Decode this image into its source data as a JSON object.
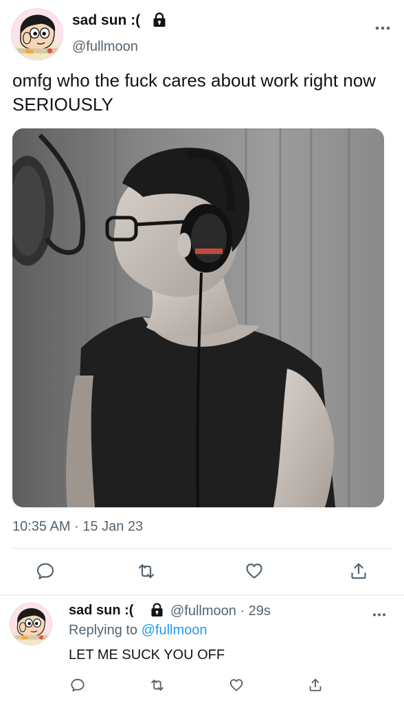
{
  "main_tweet": {
    "author": {
      "display_name": "sad sun :(",
      "handle": "@fullmoon",
      "avatar_icon": "cartoon-boy-avatar",
      "protected_icon": "lock-icon"
    },
    "text": "omfg who the fuck cares about work right now SERIOUSLY",
    "media": {
      "kind": "photo",
      "icon": "photo-man-with-headphones"
    },
    "timestamp": "10:35 AM · 15 Jan 23",
    "actions": [
      {
        "name": "reply",
        "icon": "comment-icon"
      },
      {
        "name": "retweet",
        "icon": "retweet-icon"
      },
      {
        "name": "like",
        "icon": "heart-icon"
      },
      {
        "name": "share",
        "icon": "share-icon"
      }
    ]
  },
  "reply": {
    "author": {
      "display_name": "sad sun :(",
      "handle": "@fullmoon",
      "avatar_icon": "cartoon-boy-avatar",
      "protected_icon": "lock-icon"
    },
    "meta": "@fullmoon · 29s",
    "replying_to_prefix": "Replying to",
    "replying_to_mention": "@fullmoon",
    "text": "LET ME SUCK YOU OFF"
  },
  "colors": {
    "text": "#0f1419",
    "secondary_text": "#536471",
    "link": "#1d9bf0",
    "divider": "#dfe3e6"
  }
}
